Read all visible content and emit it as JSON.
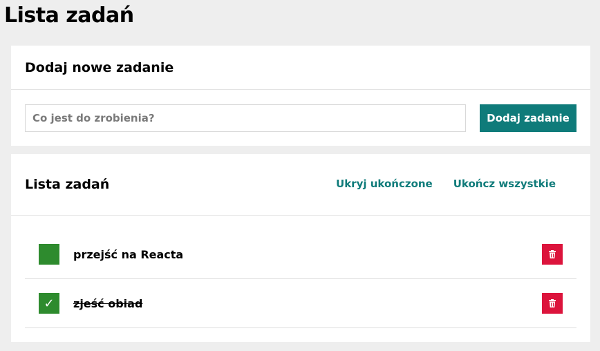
{
  "page_title": "Lista zadań",
  "add_section": {
    "title": "Dodaj nowe zadanie",
    "input_placeholder": "Co jest do zrobienia?",
    "input_value": "",
    "add_button_label": "Dodaj zadanie"
  },
  "list_section": {
    "title": "Lista zadań",
    "hide_completed_label": "Ukryj ukończone",
    "complete_all_label": "Ukończ wszystkie"
  },
  "tasks": [
    {
      "label": "przejść na Reacta",
      "done": false,
      "check_glyph": ""
    },
    {
      "label": "zjeść obiad",
      "done": true,
      "check_glyph": "✓"
    }
  ],
  "icons": {
    "delete": "trash-icon",
    "check": "checkmark-icon"
  },
  "colors": {
    "accent": "#0f7b7a",
    "checkbox": "#2e8b2e",
    "delete": "#dc143c",
    "background": "#eeeeee"
  }
}
